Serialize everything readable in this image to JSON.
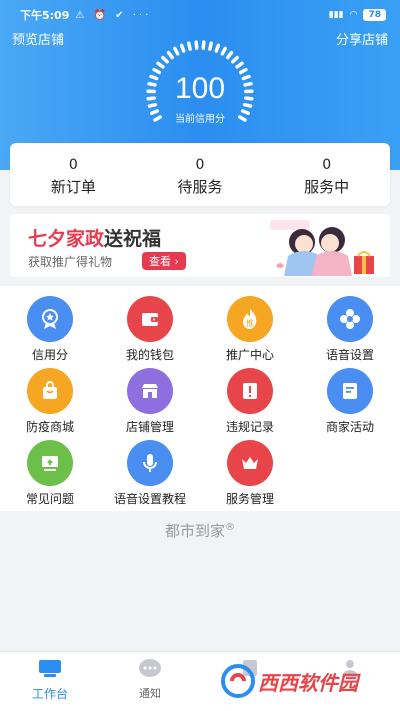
{
  "status": {
    "time": "下午5:09",
    "battery": "78"
  },
  "header": {
    "preview_shop": "预览店铺",
    "share_shop": "分享店铺",
    "score": "100",
    "score_label": "当前信用分"
  },
  "stats": [
    {
      "num": "0",
      "label": "新订单"
    },
    {
      "num": "0",
      "label": "待服务"
    },
    {
      "num": "0",
      "label": "服务中"
    }
  ],
  "banner": {
    "title_red": "七夕家政",
    "title_dark": "送祝福",
    "subtitle": "获取推广得礼物",
    "button": "查看 ›"
  },
  "grid": [
    {
      "label": "信用分",
      "icon": "badge-icon",
      "color": "#4a8ef2"
    },
    {
      "label": "我的钱包",
      "icon": "wallet-icon",
      "color": "#e8454a"
    },
    {
      "label": "推广中心",
      "icon": "promote-icon",
      "color": "#f5a623"
    },
    {
      "label": "语音设置",
      "icon": "flower-gear-icon",
      "color": "#4a8ef2"
    },
    {
      "label": "防疫商城",
      "icon": "shopping-bag-icon",
      "color": "#f5a623"
    },
    {
      "label": "店铺管理",
      "icon": "store-icon",
      "color": "#8e6fe0"
    },
    {
      "label": "违规记录",
      "icon": "alert-icon",
      "color": "#e8454a"
    },
    {
      "label": "商家活动",
      "icon": "document-icon",
      "color": "#4a8ef2"
    },
    {
      "label": "常见问题",
      "icon": "monitor-icon",
      "color": "#6cc04a"
    },
    {
      "label": "语音设置教程",
      "icon": "microphone-icon",
      "color": "#4a8ef2"
    },
    {
      "label": "服务管理",
      "icon": "crown-icon",
      "color": "#e8454a"
    }
  ],
  "brand": {
    "name": "都市到家",
    "mark": "®"
  },
  "tabbar": [
    {
      "label": "工作台",
      "icon": "desk-icon"
    },
    {
      "label": "通知",
      "icon": "chat-icon"
    }
  ],
  "watermark": {
    "text": "西西软件园"
  },
  "colors": {
    "primary": "#2b8ef0",
    "accent_red": "#e83a4f",
    "background": "#f2f3f5"
  }
}
